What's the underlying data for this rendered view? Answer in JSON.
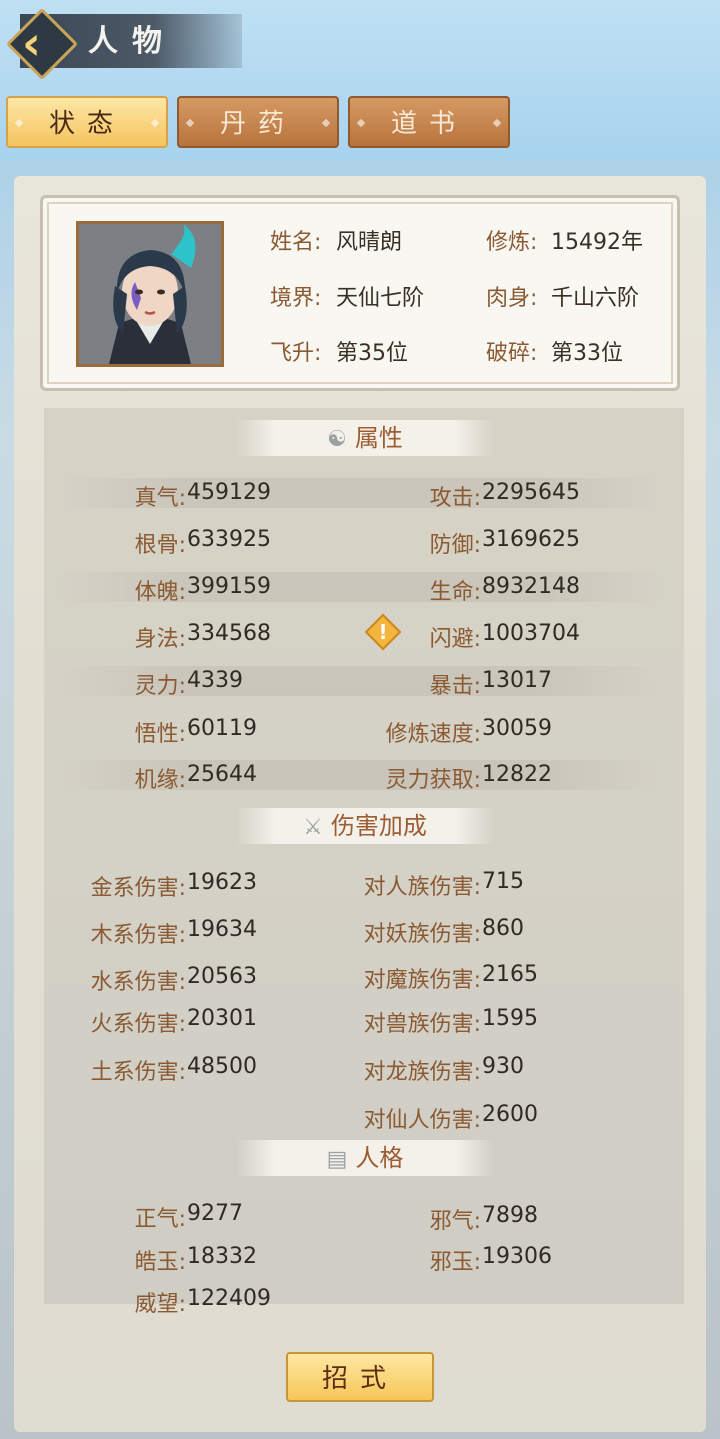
{
  "header": {
    "title": "人物",
    "back_icon": "back-arrow-icon"
  },
  "tabs": [
    {
      "label": "状态",
      "active": true
    },
    {
      "label": "丹药",
      "active": false
    },
    {
      "label": "道书",
      "active": false
    }
  ],
  "profile": {
    "name_label": "姓名",
    "name_value": "风晴朗",
    "cultivate_label": "修炼",
    "cultivate_value": "15492年",
    "realm_label": "境界",
    "realm_value": "天仙七阶",
    "body_label": "肉身",
    "body_value": "千山六阶",
    "ascend_label": "飞升",
    "ascend_value": "第35位",
    "shatter_label": "破碎",
    "shatter_value": "第33位"
  },
  "attributes": {
    "title": "属性",
    "left": [
      {
        "label": "真气",
        "value": "459129"
      },
      {
        "label": "根骨",
        "value": "633925"
      },
      {
        "label": "体魄",
        "value": "399159"
      },
      {
        "label": "身法",
        "value": "334568"
      },
      {
        "label": "灵力",
        "value": "4339"
      },
      {
        "label": "悟性",
        "value": "60119"
      },
      {
        "label": "机缘",
        "value": "25644"
      }
    ],
    "right": [
      {
        "label": "攻击",
        "value": "2295645"
      },
      {
        "label": "防御",
        "value": "3169625"
      },
      {
        "label": "生命",
        "value": "8932148"
      },
      {
        "label": "闪避",
        "value": "1003704"
      },
      {
        "label": "暴击",
        "value": "13017"
      },
      {
        "label": "修炼速度",
        "value": "30059"
      },
      {
        "label": "灵力获取",
        "value": "12822"
      }
    ]
  },
  "damage": {
    "title": "伤害加成",
    "left": [
      {
        "label": "金系伤害",
        "value": "19623"
      },
      {
        "label": "木系伤害",
        "value": "19634"
      },
      {
        "label": "水系伤害",
        "value": "20563"
      },
      {
        "label": "火系伤害",
        "value": "20301"
      },
      {
        "label": "土系伤害",
        "value": "48500"
      }
    ],
    "right": [
      {
        "label": "对人族伤害",
        "value": "715"
      },
      {
        "label": "对妖族伤害",
        "value": "860"
      },
      {
        "label": "对魔族伤害",
        "value": "2165"
      },
      {
        "label": "对兽族伤害",
        "value": "1595"
      },
      {
        "label": "对龙族伤害",
        "value": "930"
      },
      {
        "label": "对仙人伤害",
        "value": "2600"
      }
    ]
  },
  "personality": {
    "title": "人格",
    "left": [
      {
        "label": "正气",
        "value": "9277"
      },
      {
        "label": "皓玉",
        "value": "18332"
      },
      {
        "label": "威望",
        "value": "122409"
      }
    ],
    "right": [
      {
        "label": "邪气",
        "value": "7898"
      },
      {
        "label": "邪玉",
        "value": "19306"
      }
    ]
  },
  "skill_button": "招式",
  "colors": {
    "label": "#8b5a32",
    "accent": "#f6c659"
  }
}
